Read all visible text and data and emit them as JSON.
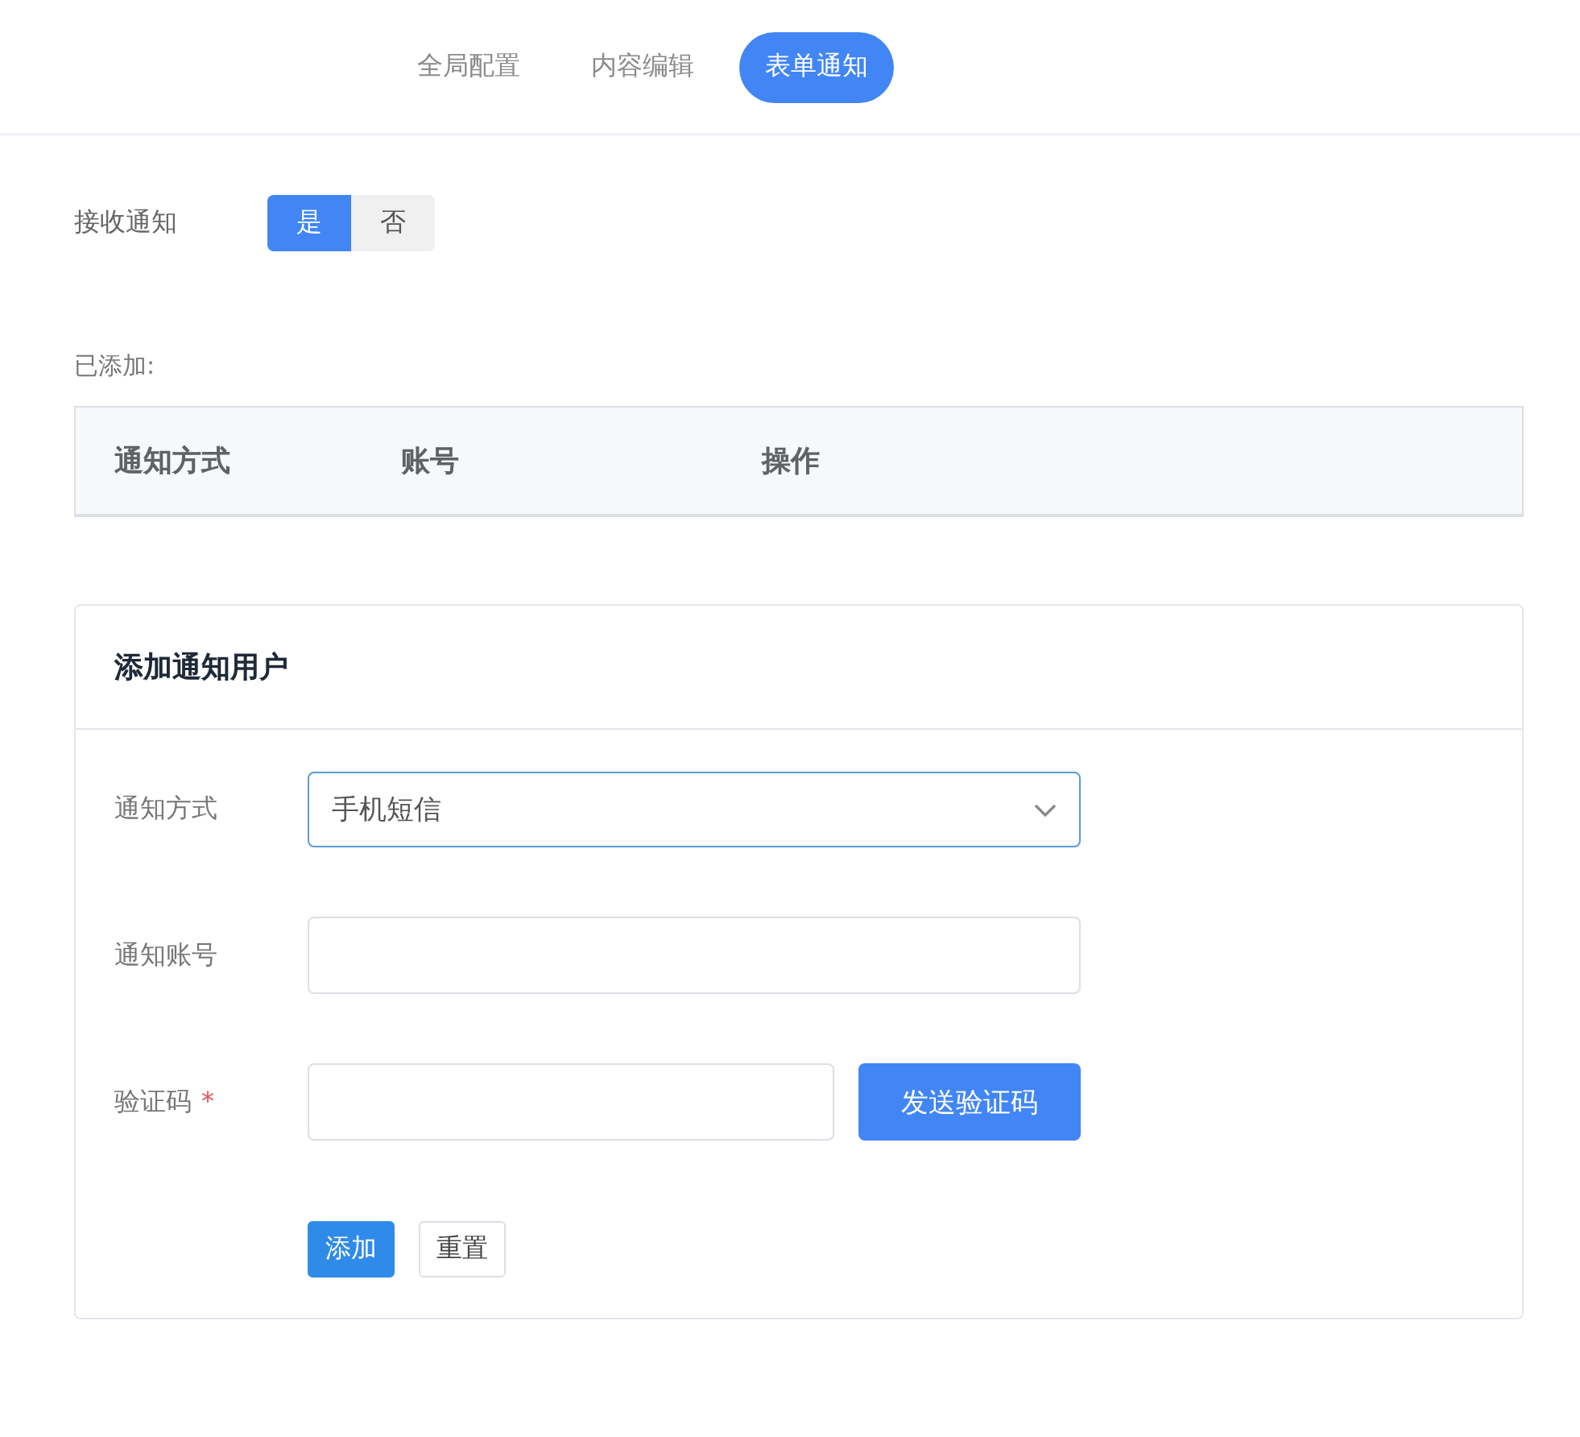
{
  "tabs": [
    {
      "label": "全局配置",
      "selected": false
    },
    {
      "label": "内容编辑",
      "selected": false
    },
    {
      "label": "表单通知",
      "selected": true
    }
  ],
  "receive_notification": {
    "label": "接收通知",
    "options": [
      {
        "label": "是",
        "selected": true
      },
      {
        "label": "否",
        "selected": false
      }
    ]
  },
  "added": {
    "label": "已添加:",
    "columns": [
      "通知方式",
      "账号",
      "操作"
    ]
  },
  "add_user_card": {
    "title": "添加通知用户",
    "fields": [
      {
        "kind": "select",
        "label": "通知方式",
        "value": "手机短信"
      },
      {
        "kind": "input",
        "label": "通知账号"
      },
      {
        "kind": "input_with_button",
        "label": "验证码",
        "required_mark": "*",
        "button": "发送验证码"
      }
    ],
    "buttons": [
      {
        "label": "添加",
        "kind": "primary"
      },
      {
        "label": "重置",
        "kind": "default"
      }
    ]
  }
}
